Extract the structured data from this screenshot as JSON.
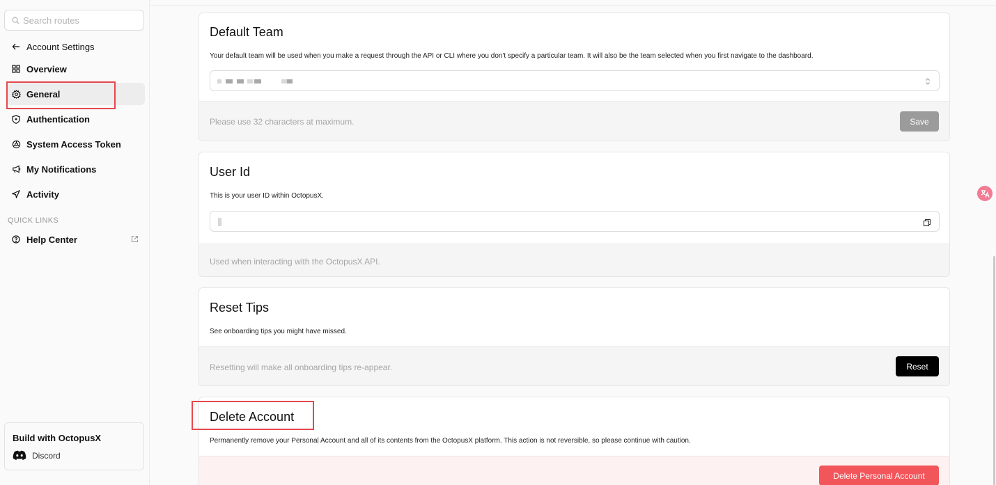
{
  "sidebar": {
    "search_placeholder": "Search routes",
    "back_label": "Account Settings",
    "items": [
      {
        "label": "Overview",
        "icon": "grid-icon"
      },
      {
        "label": "General",
        "icon": "gear-icon"
      },
      {
        "label": "Authentication",
        "icon": "shield-icon"
      },
      {
        "label": "System Access Token",
        "icon": "token-icon"
      },
      {
        "label": "My Notifications",
        "icon": "megaphone-icon"
      },
      {
        "label": "Activity",
        "icon": "send-icon"
      }
    ],
    "quick_links_label": "QUICK LINKS",
    "help_center_label": "Help Center",
    "build_title": "Build with OctopusX",
    "discord_label": "Discord"
  },
  "cards": {
    "default_team": {
      "title": "Default Team",
      "description": "Your default team will be used when you make a request through the API or CLI where you don't specify a particular team. It will also be the team selected when you first navigate to the dashboard.",
      "footer_note": "Please use 32 characters at maximum.",
      "save_label": "Save"
    },
    "user_id": {
      "title": "User Id",
      "description": "This is your user ID within OctopusX.",
      "footer_note": "Used when interacting with the OctopusX API."
    },
    "reset_tips": {
      "title": "Reset Tips",
      "description": "See onboarding tips you might have missed.",
      "footer_note": "Resetting will make all onboarding tips re-appear.",
      "reset_label": "Reset"
    },
    "delete_account": {
      "title": "Delete Account",
      "description": "Permanently remove your Personal Account and all of its contents from the OctopusX platform. This action is not reversible, so please continue with caution.",
      "delete_label": "Delete Personal Account"
    }
  },
  "colors": {
    "highlight": "#e5484d",
    "danger_button": "#f2555a",
    "danger_footer": "#fdf1f1",
    "active_nav": "#ededed"
  }
}
